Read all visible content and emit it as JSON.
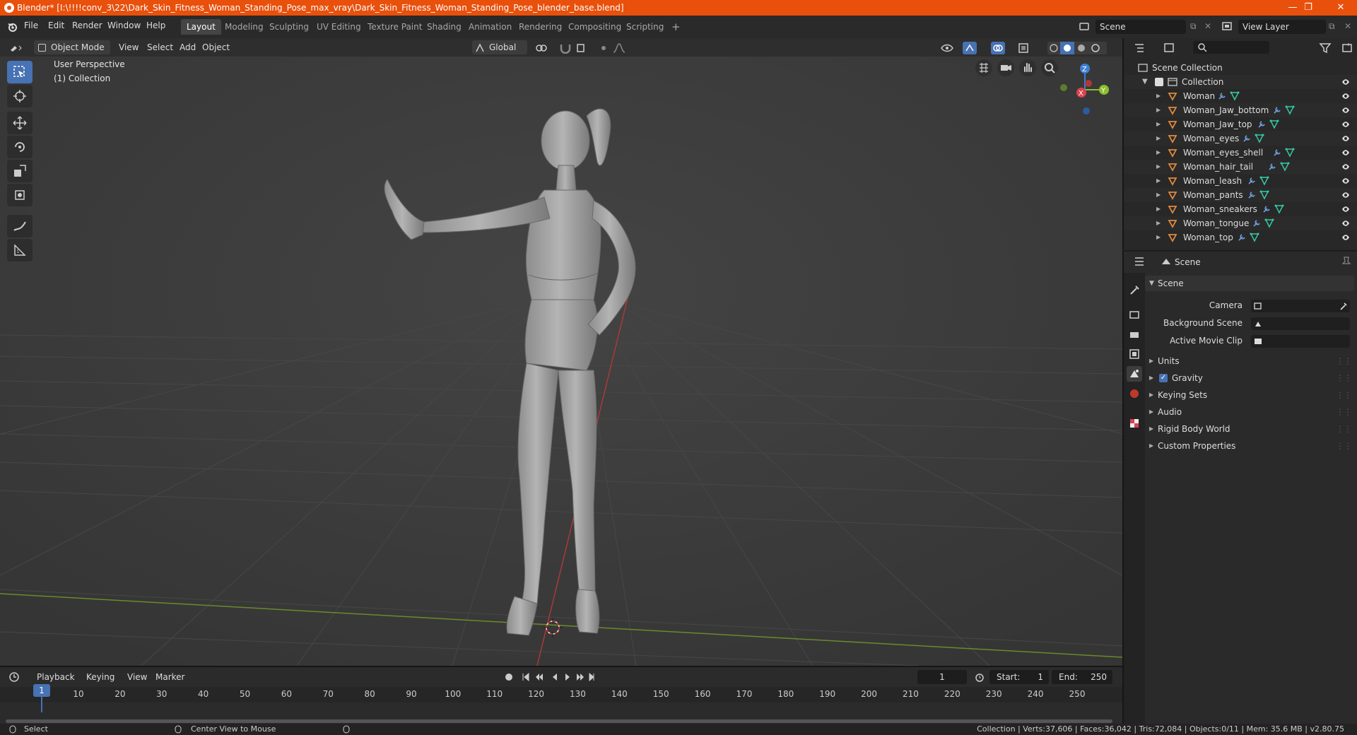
{
  "window": {
    "title": "Blender* [I:\\!!!!conv_3\\22\\Dark_Skin_Fitness_Woman_Standing_Pose_max_vray\\Dark_Skin_Fitness_Woman_Standing_Pose_blender_base.blend]",
    "minimize": "—",
    "maximize": "❐",
    "close": "✕"
  },
  "menu": [
    "File",
    "Edit",
    "Render",
    "Window",
    "Help"
  ],
  "workspaces": [
    {
      "label": "Layout",
      "active": true
    },
    {
      "label": "Modeling"
    },
    {
      "label": "Sculpting"
    },
    {
      "label": "UV Editing"
    },
    {
      "label": "Texture Paint"
    },
    {
      "label": "Shading"
    },
    {
      "label": "Animation"
    },
    {
      "label": "Rendering"
    },
    {
      "label": "Compositing"
    },
    {
      "label": "Scripting"
    }
  ],
  "add_workspace": "+",
  "scene_selector": "Scene",
  "view_layer_selector": "View Layer",
  "viewport_header": {
    "mode": "Object Mode",
    "view": "View",
    "select": "Select",
    "add": "Add",
    "object": "Object",
    "orientation": "Global"
  },
  "viewport_overlay": {
    "perspective": "User Perspective",
    "collection": "(1) Collection"
  },
  "gizmo_axes": {
    "x": "X",
    "y": "Y",
    "z": "Z"
  },
  "colors": {
    "title_bar": "#e8500c",
    "active_tool": "#4772b3",
    "mesh_icon": "#e08a3c",
    "modifier_icon": "#6fa0e0",
    "data_icon": "#35c9a3",
    "x_axis": "#d9434f",
    "y_axis": "#8bbe2c",
    "z_axis": "#3b7fd6"
  },
  "outliner": {
    "root": "Scene Collection",
    "collection": "Collection",
    "objects": [
      "Woman",
      "Woman_Jaw_bottom",
      "Woman_Jaw_top",
      "Woman_eyes",
      "Woman_eyes_shell",
      "Woman_hair_tail",
      "Woman_leash",
      "Woman_pants",
      "Woman_sneakers",
      "Woman_tongue",
      "Woman_top"
    ]
  },
  "properties": {
    "context": "Scene",
    "panel_title": "Scene",
    "fields": [
      {
        "label": "Camera"
      },
      {
        "label": "Background Scene"
      },
      {
        "label": "Active Movie Clip"
      }
    ],
    "subpanels": [
      "Units",
      "Gravity",
      "Keying Sets",
      "Audio",
      "Rigid Body World",
      "Custom Properties"
    ],
    "gravity_checked": true
  },
  "timeline": {
    "playback": "Playback",
    "keying": "Keying",
    "view": "View",
    "marker": "Marker",
    "current_frame": "1",
    "start_label": "Start:",
    "start": "1",
    "end_label": "End:",
    "end": "250",
    "ticks": [
      "1",
      "10",
      "20",
      "30",
      "40",
      "50",
      "60",
      "70",
      "80",
      "90",
      "100",
      "110",
      "120",
      "130",
      "140",
      "150",
      "160",
      "170",
      "180",
      "190",
      "200",
      "210",
      "220",
      "230",
      "240",
      "250"
    ]
  },
  "statusbar": {
    "left": "Select",
    "middle": "Center View to Mouse",
    "right": "Collection | Verts:37,606 | Faces:36,042 | Tris:72,084 | Objects:0/11 | Mem: 35.6 MB | v2.80.75"
  }
}
